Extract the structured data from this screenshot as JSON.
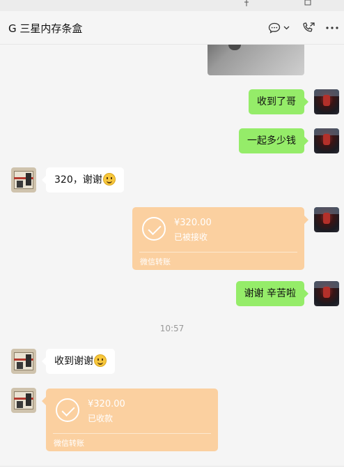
{
  "chat": {
    "title": "G 三星内存条盒"
  },
  "icons": {
    "window_pin": "pin-icon",
    "window_maximize": "maximize-icon",
    "message": "chat-bubble-icon",
    "dropdown": "chevron-down-icon",
    "call": "phone-icon",
    "more": "more-icon"
  },
  "messages": {
    "m1": {
      "sender": "me",
      "text": "收到了哥"
    },
    "m2": {
      "sender": "me",
      "text": "一起多少钱"
    },
    "m3": {
      "sender": "other",
      "text": "320，谢谢"
    },
    "t1": {
      "sender": "me",
      "amount": "¥320.00",
      "status": "已被接收",
      "footer": "微信转账"
    },
    "m4": {
      "sender": "me",
      "text": "谢谢 辛苦啦"
    },
    "time": "10:57",
    "m5": {
      "sender": "other",
      "text": "收到谢谢"
    },
    "t2": {
      "sender": "other",
      "amount": "¥320.00",
      "status": "已收款",
      "footer": "微信转账"
    }
  },
  "colors": {
    "my_bubble": "#95ec69",
    "other_bubble": "#ffffff",
    "transfer": "#fbd0a0",
    "background": "#f5f5f5"
  }
}
